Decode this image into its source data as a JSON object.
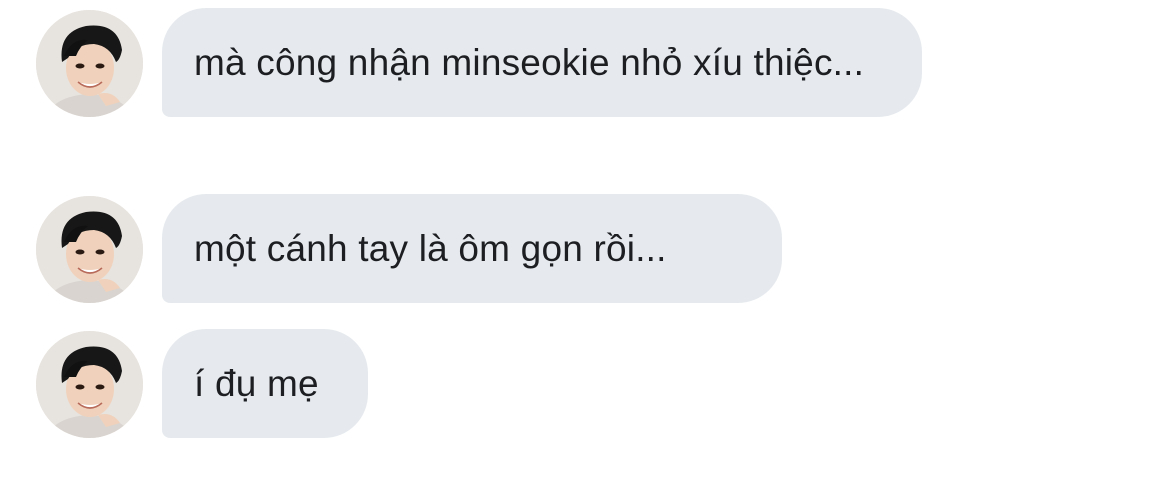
{
  "conversation": {
    "messages": [
      {
        "text": "mà công nhận minseokie nhỏ xíu thiệc..."
      },
      {
        "text": "một cánh tay là ôm gọn rồi..."
      },
      {
        "text": "í đụ mẹ"
      }
    ]
  },
  "colors": {
    "bubble_background": "#e6eaee",
    "text": "#1c1e21",
    "page_background": "#ffffff"
  },
  "icons": {
    "avatar": "avatar-photo"
  }
}
